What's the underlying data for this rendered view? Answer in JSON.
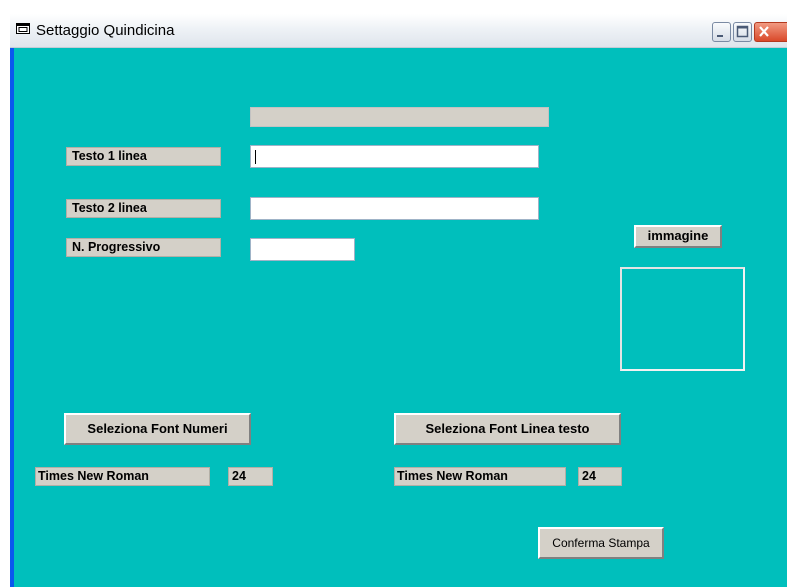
{
  "window": {
    "title": "Settaggio Quindicina",
    "icon": "window-app-icon"
  },
  "titlebar_buttons": {
    "minimize": "minimize-icon",
    "maximize": "maximize-icon",
    "close": "close-icon"
  },
  "form": {
    "testo1_label": "Testo 1 linea",
    "testo1_value": "",
    "testo2_label": "Testo 2 linea",
    "testo2_value": "",
    "progressivo_label": "N. Progressivo",
    "progressivo_value": "",
    "header_value": ""
  },
  "immagine_button": "immagine",
  "font_numeri": {
    "button": "Seleziona Font Numeri",
    "font_name": "Times New Roman",
    "size": "24"
  },
  "font_testo": {
    "button": "Seleziona Font Linea testo",
    "font_name": "Times New Roman",
    "size": "24"
  },
  "confirm_button": "Conferma Stampa",
  "colors": {
    "client_bg": "#00bfbc",
    "control_bg": "#d4d0c8",
    "close_button": "#e2573b"
  }
}
